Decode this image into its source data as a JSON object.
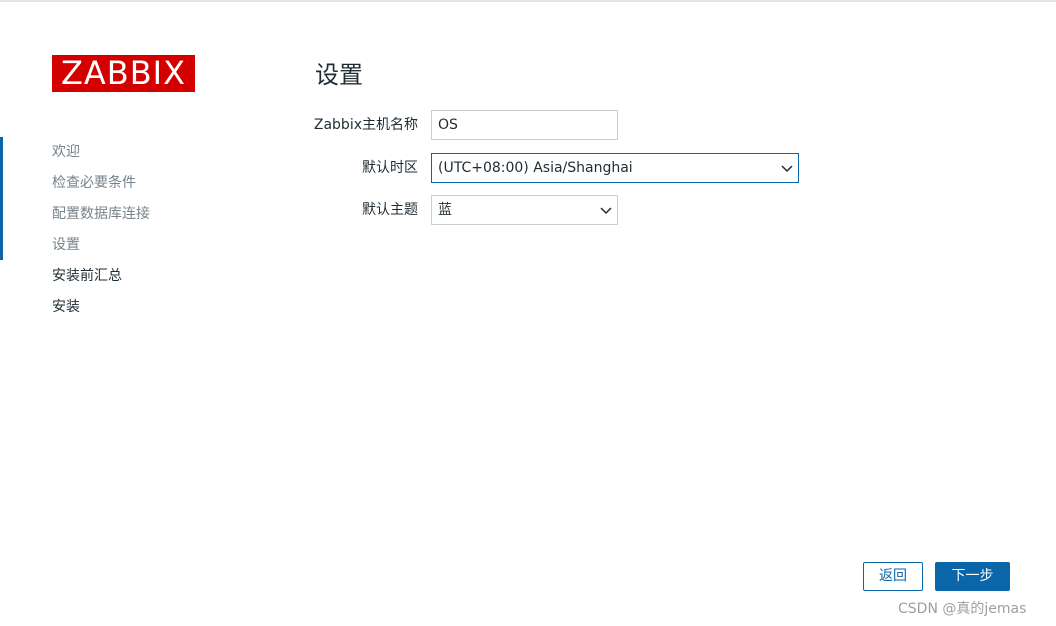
{
  "logo": {
    "text": "ZABBIX",
    "color": "#d40000"
  },
  "sidebar": {
    "steps": [
      {
        "label": "欢迎",
        "state": "done"
      },
      {
        "label": "检查必要条件",
        "state": "done"
      },
      {
        "label": "配置数据库连接",
        "state": "done"
      },
      {
        "label": "设置",
        "state": "current"
      },
      {
        "label": "安装前汇总",
        "state": "pending"
      },
      {
        "label": "安装",
        "state": "pending"
      }
    ],
    "progress_color": "#0a66a8"
  },
  "main": {
    "title": "设置",
    "form": {
      "hostname": {
        "label": "Zabbix主机名称",
        "value": "OS"
      },
      "timezone": {
        "label": "默认时区",
        "value": "(UTC+08:00) Asia/Shanghai"
      },
      "theme": {
        "label": "默认主题",
        "value": "蓝"
      }
    }
  },
  "buttons": {
    "back_label": "返回",
    "next_label": "下一步",
    "accent": "#0a66a8"
  },
  "watermark": "CSDN @真的jemas"
}
